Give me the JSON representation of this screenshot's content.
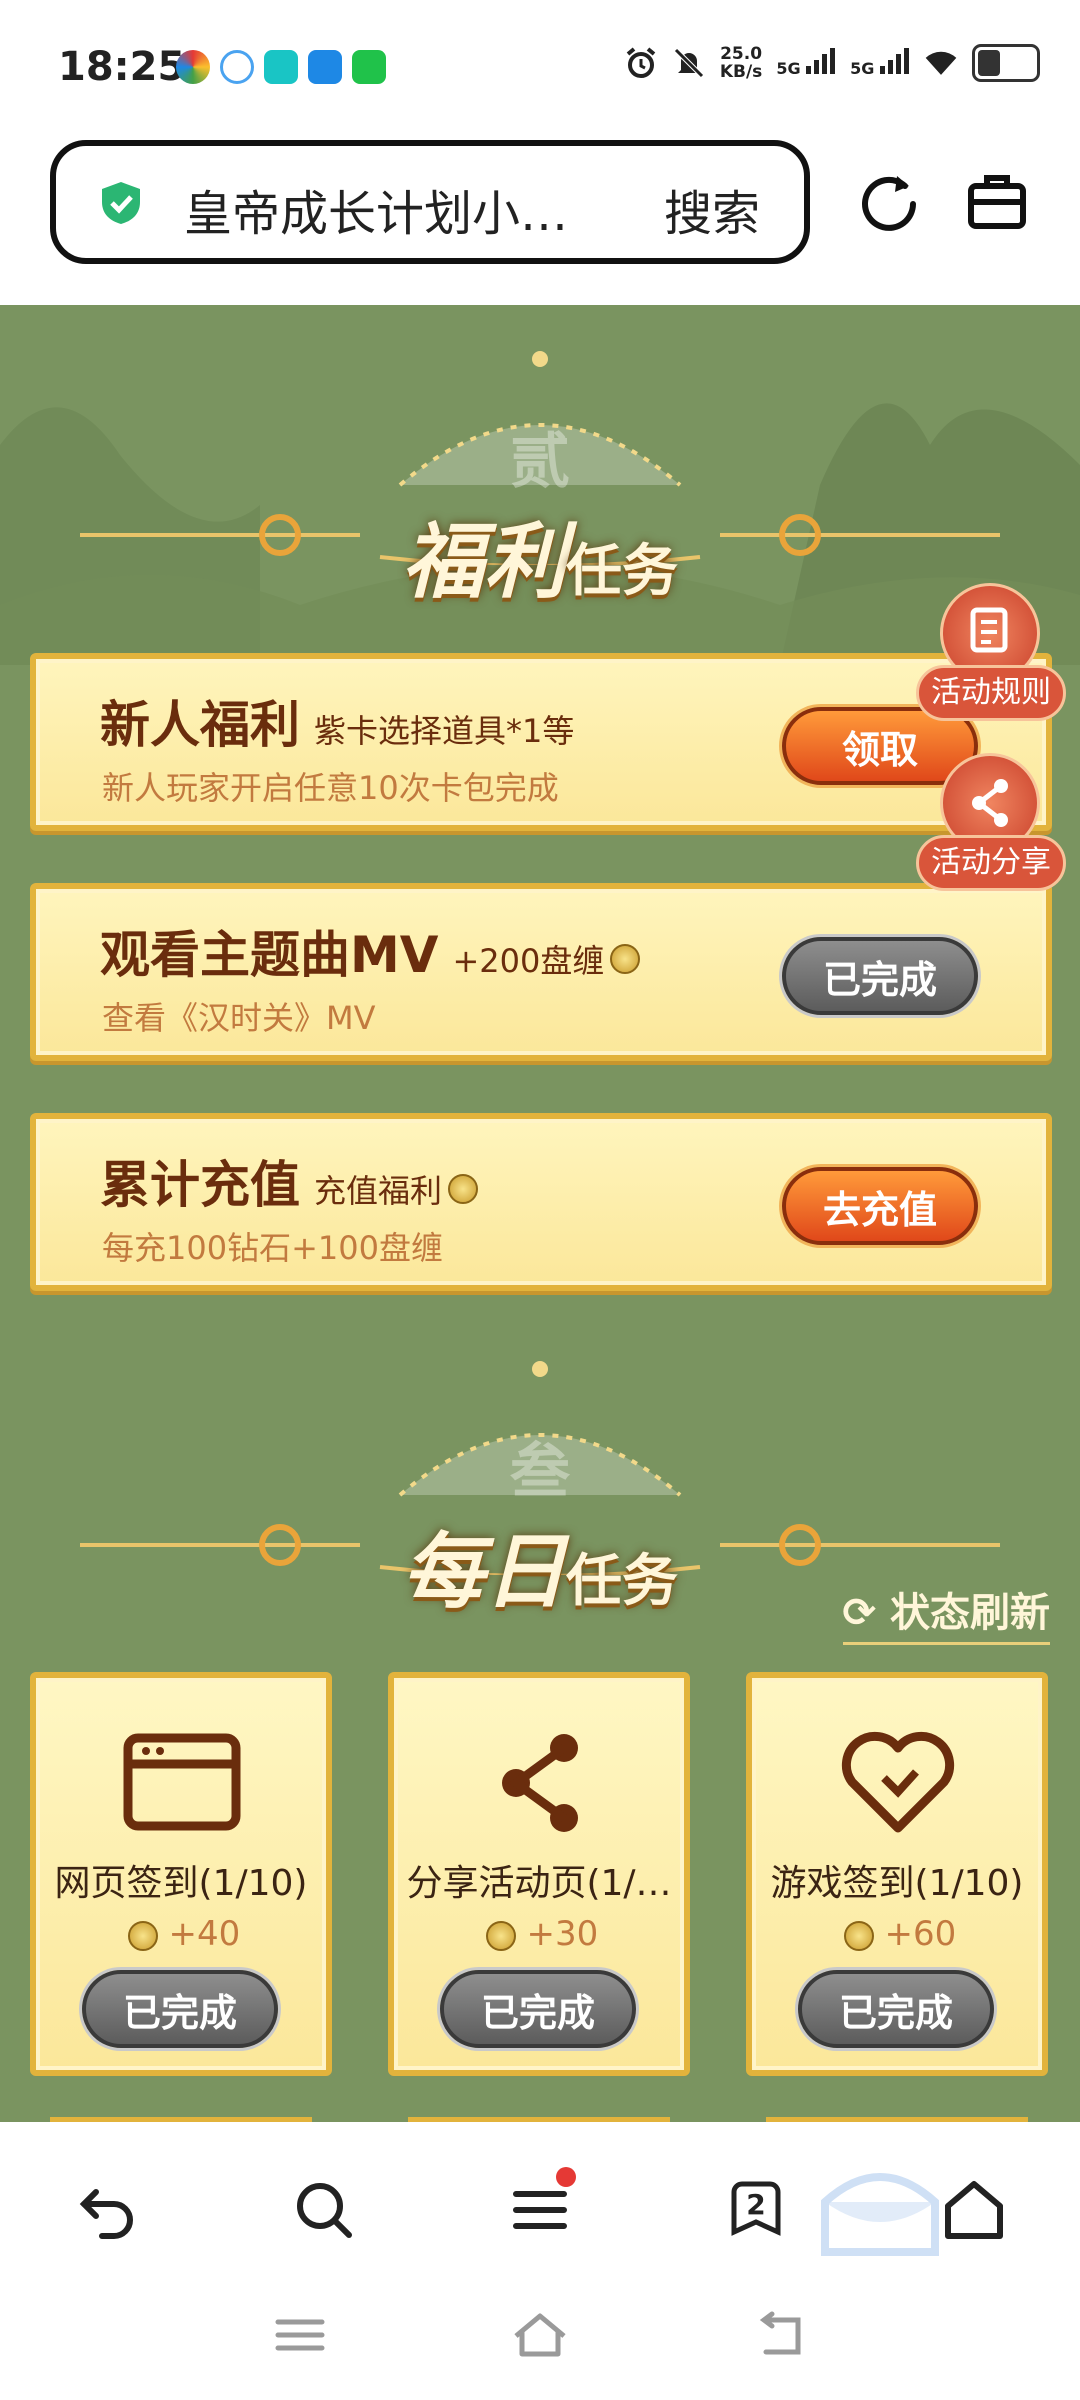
{
  "status_bar": {
    "time": "18:25",
    "net_speed_value": "25.0",
    "net_speed_unit": "KB/s",
    "signal1": "5G",
    "signal2": "5G",
    "icons": [
      "alarm-icon",
      "mute-icon",
      "wifi-icon",
      "battery-icon"
    ]
  },
  "search": {
    "query": "皇帝成长计划小…",
    "button": "搜索"
  },
  "welfare_section": {
    "bg_char": "贰",
    "title_big": "福利",
    "title_small": "任务",
    "tasks": [
      {
        "title": "新人福利",
        "tag": "紫卡选择道具*1等",
        "desc": "新人玩家开启任意10次卡包完成",
        "button": "领取",
        "state": "active"
      },
      {
        "title": "观看主题曲MV",
        "tag": "+200盘缠",
        "desc": "查看《汉时关》MV",
        "button": "已完成",
        "state": "done"
      },
      {
        "title": "累计充值",
        "tag": "充值福利",
        "desc": "每充100钻石+100盘缠",
        "button": "去充值",
        "state": "active"
      }
    ]
  },
  "side_buttons": {
    "rules": "活动规则",
    "share": "活动分享"
  },
  "daily_section": {
    "bg_char": "叁",
    "title_big": "每日",
    "title_small": "任务",
    "refresh_label": "状态刷新",
    "tasks": [
      {
        "name": "网页签到(1/10)",
        "reward": "+40",
        "button": "已完成",
        "icon": "browser-window-icon"
      },
      {
        "name": "分享活动页(1/…",
        "reward": "+30",
        "button": "已完成",
        "icon": "share-icon"
      },
      {
        "name": "游戏签到(1/10)",
        "reward": "+60",
        "button": "已完成",
        "icon": "heart-handshake-icon"
      }
    ]
  },
  "bottom_nav": {
    "tabs_count": "2",
    "icons": [
      "back-arrow-icon",
      "search-icon",
      "menu-icon",
      "tabs-icon",
      "home-icon"
    ]
  },
  "colors": {
    "page_bg": "#7a9460",
    "card_bg": "#fbe79a",
    "title_brown": "#6a2d0d",
    "button_orange": "#e0481a",
    "button_gray": "#5c5c5c"
  }
}
